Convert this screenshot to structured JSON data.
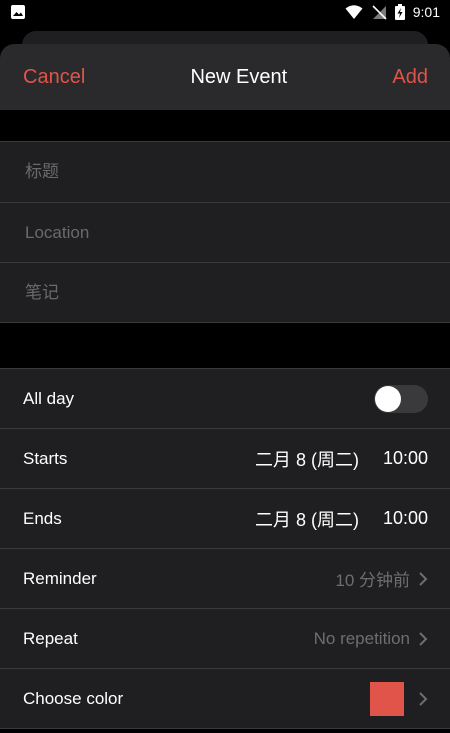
{
  "status_bar": {
    "time": "9:01",
    "icons": [
      "image-icon",
      "wifi-icon",
      "no-sim-icon",
      "battery-charging-icon"
    ]
  },
  "nav": {
    "cancel": "Cancel",
    "title": "New Event",
    "add": "Add"
  },
  "fields": {
    "title_placeholder": "标题",
    "location_placeholder": "Location",
    "notes_placeholder": "笔记"
  },
  "settings": {
    "all_day": {
      "label": "All day",
      "enabled": false
    },
    "starts": {
      "label": "Starts",
      "date": "二月 8 (周二)",
      "time": "10:00"
    },
    "ends": {
      "label": "Ends",
      "date": "二月 8 (周二)",
      "time": "10:00"
    },
    "reminder": {
      "label": "Reminder",
      "value": "10 分钟前"
    },
    "repeat": {
      "label": "Repeat",
      "value": "No repetition"
    },
    "color": {
      "label": "Choose color",
      "value": "#e0544a"
    }
  },
  "colors": {
    "accent": "#e0544a",
    "background": "#000000",
    "surface": "#1f1f21"
  }
}
